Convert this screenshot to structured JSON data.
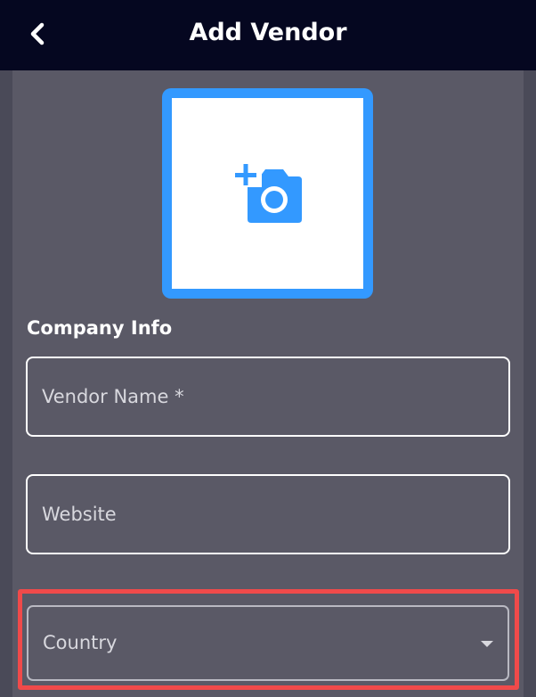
{
  "header": {
    "title": "Add Vendor",
    "back_icon": "chevron-left-icon",
    "background": "#050720"
  },
  "photo": {
    "icon": "add-photo-icon",
    "border_color": "#3399ff"
  },
  "form": {
    "section_title": "Company Info",
    "vendor_name": {
      "placeholder": "Vendor Name *",
      "value": ""
    },
    "website": {
      "placeholder": "Website",
      "value": ""
    },
    "country": {
      "placeholder": "Country",
      "icon": "caret-down-icon"
    }
  },
  "highlight_color": "#f04a4a"
}
